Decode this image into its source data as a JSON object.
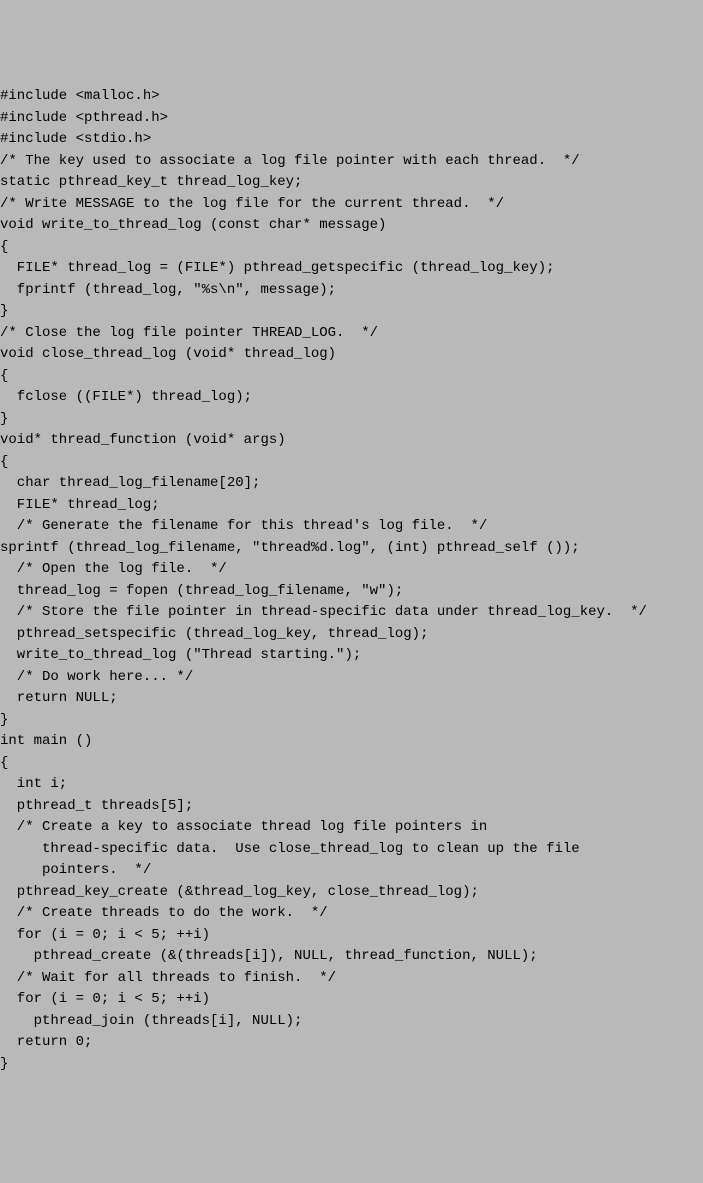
{
  "code_lines": [
    "#include <malloc.h>",
    "#include <pthread.h>",
    "#include <stdio.h>",
    "/* The key used to associate a log file pointer with each thread.  */",
    "static pthread_key_t thread_log_key;",
    "/* Write MESSAGE to the log file for the current thread.  */",
    "void write_to_thread_log (const char* message)",
    "{",
    "  FILE* thread_log = (FILE*) pthread_getspecific (thread_log_key);",
    "  fprintf (thread_log, \"%s\\n\", message);",
    "}",
    "/* Close the log file pointer THREAD_LOG.  */",
    "void close_thread_log (void* thread_log)",
    "{",
    "  fclose ((FILE*) thread_log);",
    "}",
    "void* thread_function (void* args)",
    "{",
    "  char thread_log_filename[20];",
    "  FILE* thread_log;",
    "  /* Generate the filename for this thread's log file.  */",
    "sprintf (thread_log_filename, \"thread%d.log\", (int) pthread_self ());",
    "  /* Open the log file.  */",
    "  thread_log = fopen (thread_log_filename, \"w\");",
    "  /* Store the file pointer in thread-specific data under thread_log_key.  */",
    "  pthread_setspecific (thread_log_key, thread_log);",
    "  write_to_thread_log (\"Thread starting.\");",
    "  /* Do work here... */",
    "  return NULL;",
    "}",
    "int main ()",
    "{",
    "  int i;",
    "  pthread_t threads[5];",
    "  /* Create a key to associate thread log file pointers in",
    "     thread-specific data.  Use close_thread_log to clean up the file",
    "     pointers.  */",
    "  pthread_key_create (&thread_log_key, close_thread_log);",
    "  /* Create threads to do the work.  */",
    "  for (i = 0; i < 5; ++i)",
    "    pthread_create (&(threads[i]), NULL, thread_function, NULL);",
    "  /* Wait for all threads to finish.  */",
    "  for (i = 0; i < 5; ++i)",
    "    pthread_join (threads[i], NULL);",
    "  return 0;",
    "}"
  ]
}
